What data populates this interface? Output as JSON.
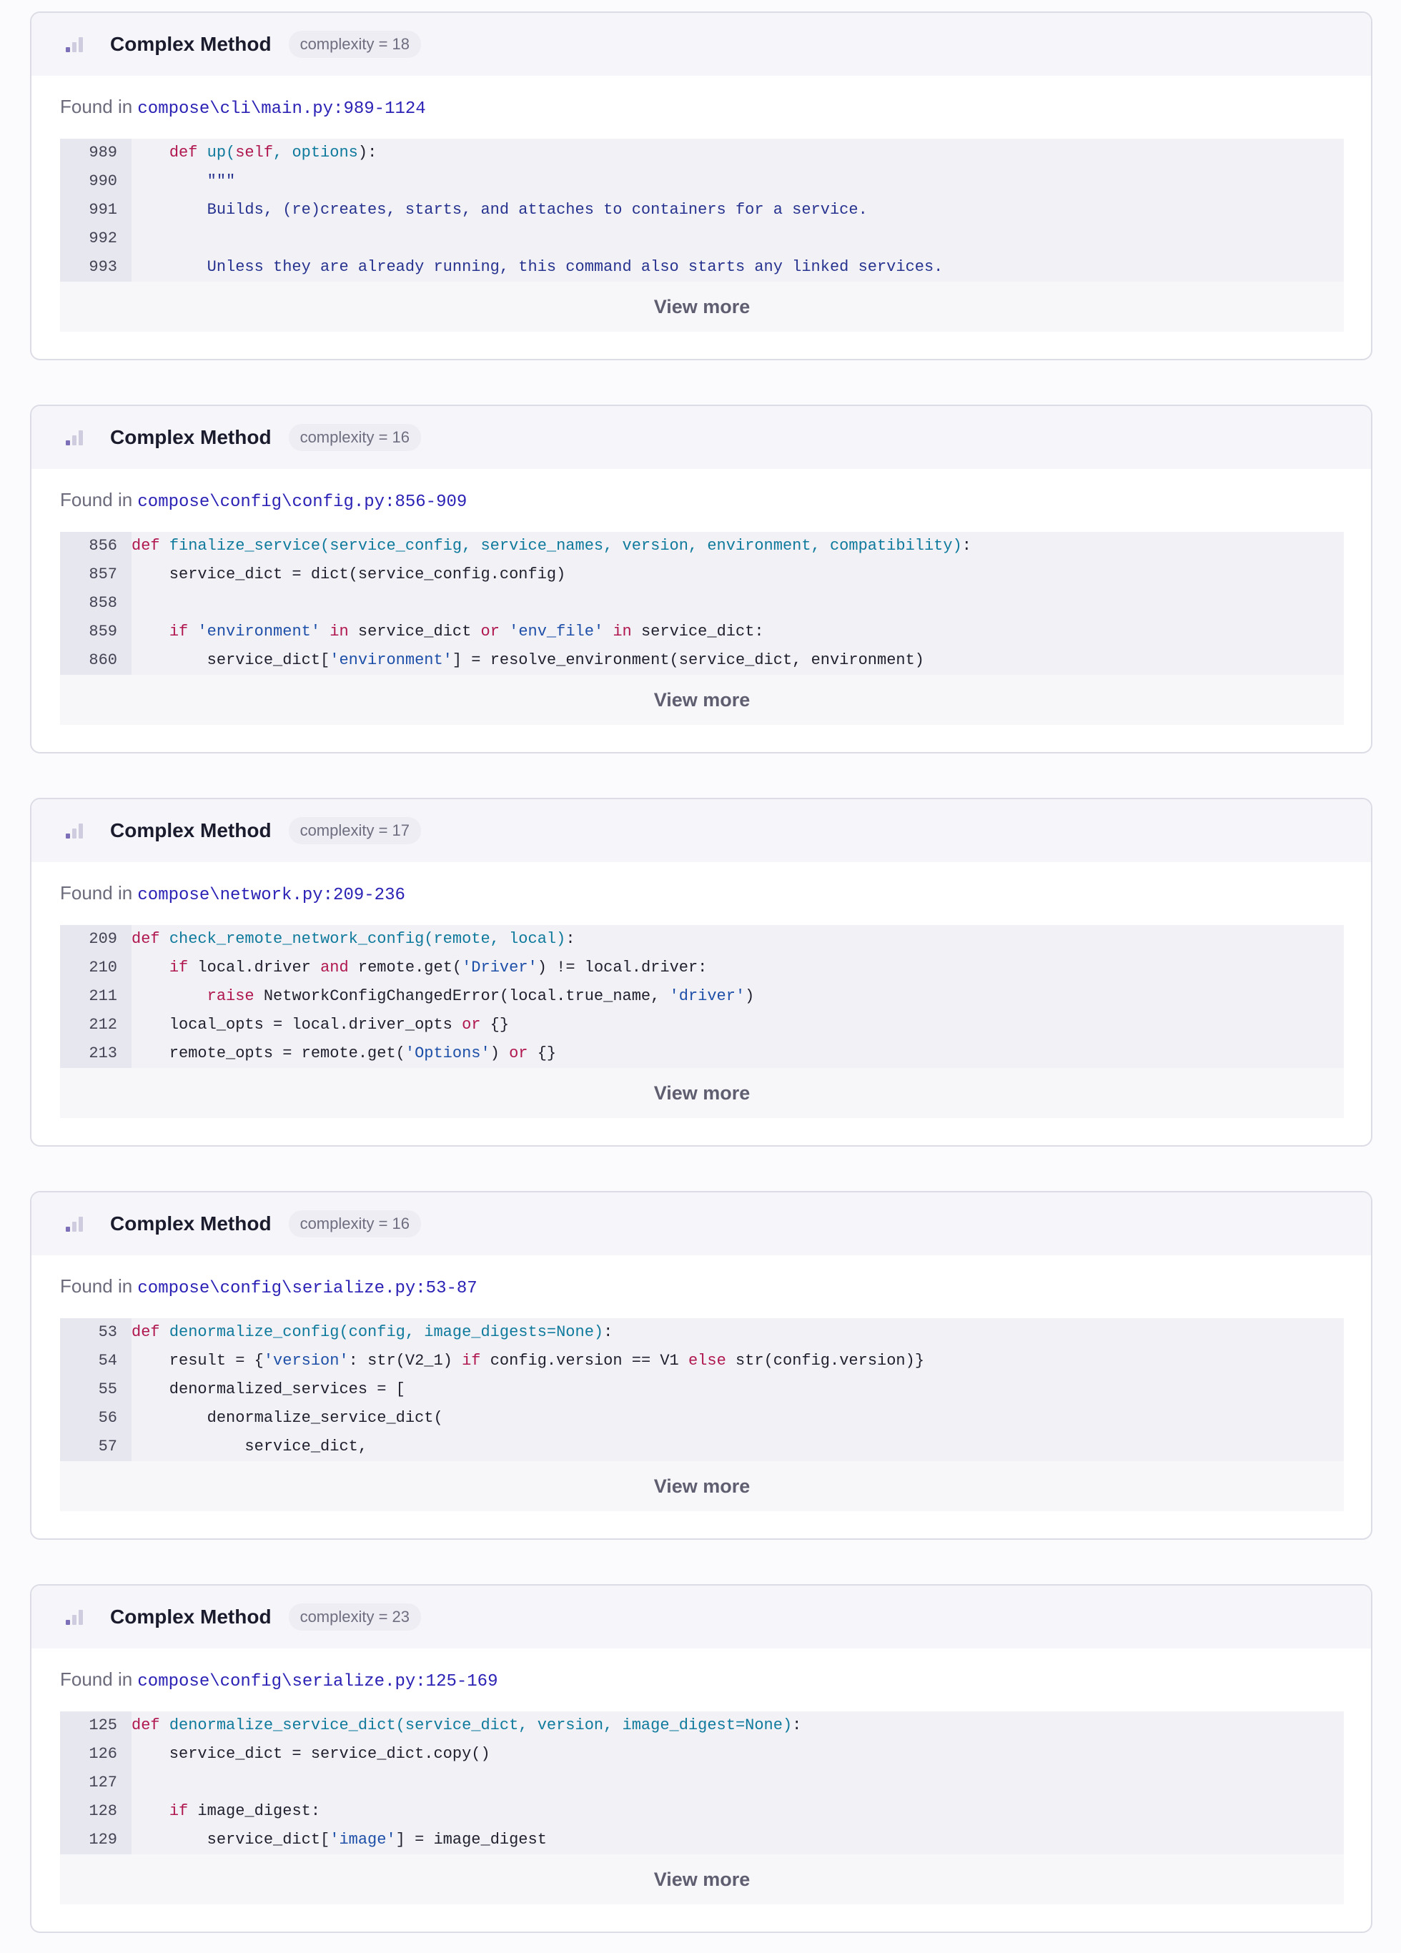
{
  "issues": [
    {
      "title": "Complex Method",
      "badge": "complexity = 18",
      "found_prefix": "Found in ",
      "path": "compose\\cli\\main.py:989-1124",
      "view_more": "View more",
      "lines": [
        {
          "n": "989",
          "t": [
            [
              "    ",
              ""
            ],
            [
              "def",
              "k"
            ],
            [
              " ",
              ""
            ],
            [
              "up(",
              "n"
            ],
            [
              "self",
              "k"
            ],
            [
              ", options",
              "n"
            ],
            [
              "):",
              ""
            ]
          ]
        },
        {
          "n": "990",
          "t": [
            [
              "        \"\"\"",
              "doc"
            ]
          ]
        },
        {
          "n": "991",
          "t": [
            [
              "        Builds, (re)creates, starts, and attaches to containers for a service.",
              "doc"
            ]
          ]
        },
        {
          "n": "992",
          "t": [
            [
              "",
              ""
            ]
          ]
        },
        {
          "n": "993",
          "t": [
            [
              "        Unless they are already running, this command also starts any linked services.",
              "doc"
            ]
          ]
        }
      ]
    },
    {
      "title": "Complex Method",
      "badge": "complexity = 16",
      "found_prefix": "Found in ",
      "path": "compose\\config\\config.py:856-909",
      "view_more": "View more",
      "lines": [
        {
          "n": "856",
          "t": [
            [
              "def",
              "k"
            ],
            [
              " ",
              ""
            ],
            [
              "finalize_service(service_config, service_names, version, environment, compatibility)",
              "n"
            ],
            [
              ":",
              ""
            ]
          ]
        },
        {
          "n": "857",
          "t": [
            [
              "    service_dict = dict(service_config.config)",
              ""
            ]
          ]
        },
        {
          "n": "858",
          "t": [
            [
              "",
              ""
            ]
          ]
        },
        {
          "n": "859",
          "t": [
            [
              "    ",
              ""
            ],
            [
              "if",
              "k"
            ],
            [
              " ",
              ""
            ],
            [
              "'environment'",
              "s"
            ],
            [
              " ",
              ""
            ],
            [
              "in",
              "k"
            ],
            [
              " service_dict ",
              ""
            ],
            [
              "or",
              "k"
            ],
            [
              " ",
              ""
            ],
            [
              "'env_file'",
              "s"
            ],
            [
              " ",
              ""
            ],
            [
              "in",
              "k"
            ],
            [
              " service_dict:",
              ""
            ]
          ]
        },
        {
          "n": "860",
          "t": [
            [
              "        service_dict[",
              ""
            ],
            [
              "'environment'",
              "s"
            ],
            [
              "] = resolve_environment(service_dict, environment)",
              ""
            ]
          ]
        }
      ]
    },
    {
      "title": "Complex Method",
      "badge": "complexity = 17",
      "found_prefix": "Found in ",
      "path": "compose\\network.py:209-236",
      "view_more": "View more",
      "lines": [
        {
          "n": "209",
          "t": [
            [
              "def",
              "k"
            ],
            [
              " ",
              ""
            ],
            [
              "check_remote_network_config(remote, local)",
              "n"
            ],
            [
              ":",
              ""
            ]
          ]
        },
        {
          "n": "210",
          "t": [
            [
              "    ",
              ""
            ],
            [
              "if",
              "k"
            ],
            [
              " local.driver ",
              ""
            ],
            [
              "and",
              "k"
            ],
            [
              " remote.get(",
              ""
            ],
            [
              "'Driver'",
              "s"
            ],
            [
              ") != local.driver:",
              ""
            ]
          ]
        },
        {
          "n": "211",
          "t": [
            [
              "        ",
              ""
            ],
            [
              "raise",
              "k"
            ],
            [
              " NetworkConfigChangedError(local.true_name, ",
              ""
            ],
            [
              "'driver'",
              "s"
            ],
            [
              ")",
              ""
            ]
          ]
        },
        {
          "n": "212",
          "t": [
            [
              "    local_opts = local.driver_opts ",
              ""
            ],
            [
              "or",
              "k"
            ],
            [
              " {}",
              ""
            ]
          ]
        },
        {
          "n": "213",
          "t": [
            [
              "    remote_opts = remote.get(",
              ""
            ],
            [
              "'Options'",
              "s"
            ],
            [
              ") ",
              ""
            ],
            [
              "or",
              "k"
            ],
            [
              " {}",
              ""
            ]
          ]
        }
      ]
    },
    {
      "title": "Complex Method",
      "badge": "complexity = 16",
      "found_prefix": "Found in ",
      "path": "compose\\config\\serialize.py:53-87",
      "view_more": "View more",
      "lines": [
        {
          "n": "53",
          "t": [
            [
              "def",
              "k"
            ],
            [
              " ",
              ""
            ],
            [
              "denormalize_config(config, image_digests=None)",
              "n"
            ],
            [
              ":",
              ""
            ]
          ]
        },
        {
          "n": "54",
          "t": [
            [
              "    result = {",
              ""
            ],
            [
              "'version'",
              "s"
            ],
            [
              ": str(V2_1) ",
              ""
            ],
            [
              "if",
              "k"
            ],
            [
              " config.version == V1 ",
              ""
            ],
            [
              "else",
              "k"
            ],
            [
              " str(config.version)}",
              ""
            ]
          ]
        },
        {
          "n": "55",
          "t": [
            [
              "    denormalized_services = [",
              ""
            ]
          ]
        },
        {
          "n": "56",
          "t": [
            [
              "        denormalize_service_dict(",
              ""
            ]
          ]
        },
        {
          "n": "57",
          "t": [
            [
              "            service_dict,",
              ""
            ]
          ]
        }
      ]
    },
    {
      "title": "Complex Method",
      "badge": "complexity = 23",
      "found_prefix": "Found in ",
      "path": "compose\\config\\serialize.py:125-169",
      "view_more": "View more",
      "lines": [
        {
          "n": "125",
          "t": [
            [
              "def",
              "k"
            ],
            [
              " ",
              ""
            ],
            [
              "denormalize_service_dict(service_dict, version, image_digest=None)",
              "n"
            ],
            [
              ":",
              ""
            ]
          ]
        },
        {
          "n": "126",
          "t": [
            [
              "    service_dict = service_dict.copy()",
              ""
            ]
          ]
        },
        {
          "n": "127",
          "t": [
            [
              "",
              ""
            ]
          ]
        },
        {
          "n": "128",
          "t": [
            [
              "    ",
              ""
            ],
            [
              "if",
              "k"
            ],
            [
              " image_digest:",
              ""
            ]
          ]
        },
        {
          "n": "129",
          "t": [
            [
              "        service_dict[",
              ""
            ],
            [
              "'image'",
              "s"
            ],
            [
              "] = image_digest",
              ""
            ]
          ]
        }
      ]
    }
  ]
}
